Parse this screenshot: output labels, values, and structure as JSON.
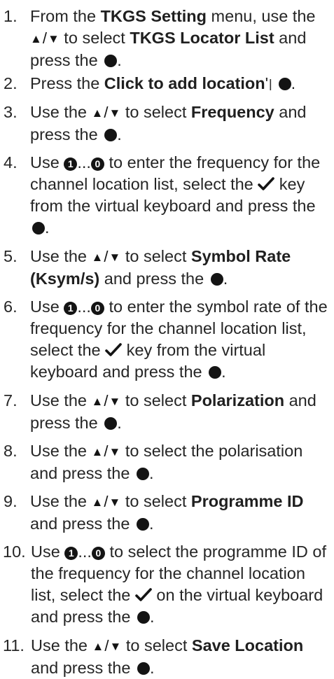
{
  "steps": [
    {
      "number": "1.",
      "text": [
        "From the ",
        {
          "b": "TKGS Setting"
        },
        " menu, use the ",
        {
          "icon": "arrows"
        },
        " to select ",
        {
          "b": "TKGS Locator List"
        },
        " and press the ",
        {
          "icon": "dot"
        },
        "."
      ]
    },
    {
      "number": "2.",
      "text": [
        "Press the ",
        {
          "b": "Click to add location"
        },
        "'",
        {
          "icon": "tick"
        },
        " ",
        {
          "icon": "dot"
        },
        "."
      ]
    },
    {
      "number": "3.",
      "text": [
        "Use the ",
        {
          "icon": "arrows"
        },
        " to select ",
        {
          "b": "Frequency"
        },
        " and press the ",
        {
          "icon": "dot"
        },
        "."
      ]
    },
    {
      "number": "4.",
      "text": [
        "Use ",
        {
          "icon": "digit1"
        },
        "...",
        {
          "icon": "digit0"
        },
        " to enter the frequency for the channel location list, select the ",
        {
          "icon": "check"
        },
        " key from the virtual keyboard and press the ",
        {
          "icon": "dot"
        },
        "."
      ]
    },
    {
      "number": "5.",
      "text": [
        "Use the ",
        {
          "icon": "arrows"
        },
        " to select ",
        {
          "b": "Symbol Rate (Ksym/s)"
        },
        " and press the ",
        {
          "icon": "dot"
        },
        "."
      ]
    },
    {
      "number": "6.",
      "text": [
        "Use ",
        {
          "icon": "digit1"
        },
        "...",
        {
          "icon": "digit0"
        },
        " to enter the symbol rate of the frequency for the channel location list, select the ",
        {
          "icon": "check"
        },
        " key from the virtual keyboard and press the ",
        {
          "icon": "dot"
        },
        "."
      ]
    },
    {
      "number": "7.",
      "text": [
        "Use the ",
        {
          "icon": "arrows"
        },
        " to select ",
        {
          "b": "Polarization"
        },
        " and press the ",
        {
          "icon": "dot"
        },
        "."
      ]
    },
    {
      "number": "8.",
      "text": [
        "Use the ",
        {
          "icon": "arrows"
        },
        " to select the polarisation and press the ",
        {
          "icon": "dot"
        },
        "."
      ]
    },
    {
      "number": "9.",
      "text": [
        "Use the ",
        {
          "icon": "arrows"
        },
        " to select ",
        {
          "b": "Programme ID"
        },
        " and press the ",
        {
          "icon": "dot"
        },
        "."
      ]
    },
    {
      "number": "10.",
      "text": [
        "Use ",
        {
          "icon": "digit1"
        },
        "...",
        {
          "icon": "digit0"
        },
        " to select the programme ID of the frequency for the channel location list, select the ",
        {
          "icon": "check"
        },
        " on the virtual keyboard and press the ",
        {
          "icon": "dot"
        },
        "."
      ]
    },
    {
      "number": "11.",
      "text": [
        "Use the ",
        {
          "icon": "arrows"
        },
        " to select ",
        {
          "b": "Save Location"
        },
        " and press the ",
        {
          "icon": "dot"
        },
        "."
      ]
    }
  ],
  "icons": {
    "arrows": {
      "up": "▲",
      "slash": "/",
      "down": "▼"
    },
    "digit1": "1",
    "digit0": "0"
  }
}
